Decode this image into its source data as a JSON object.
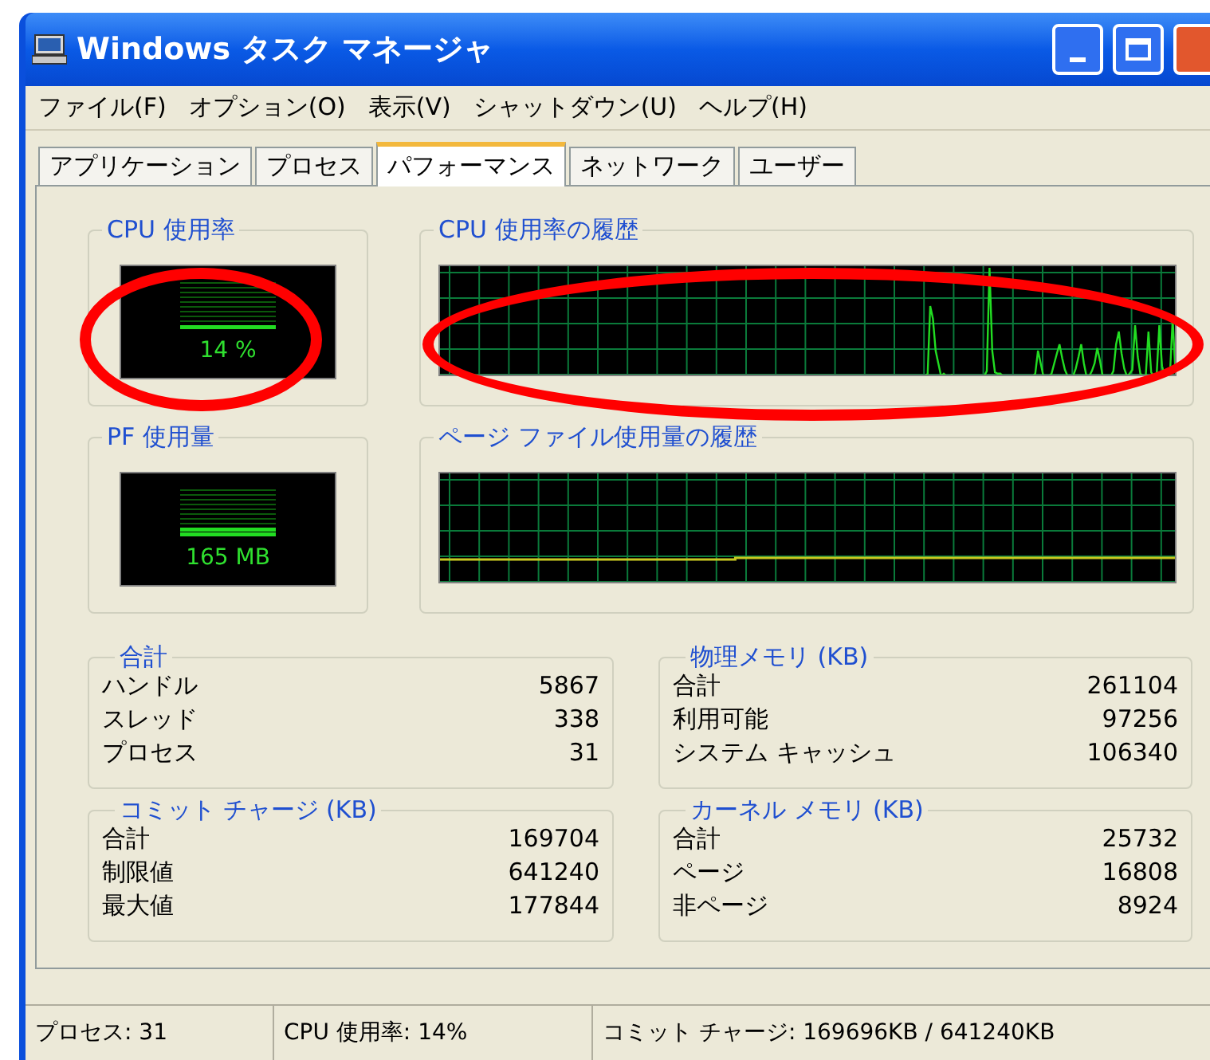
{
  "window": {
    "title": "Windows タスク マネージャ"
  },
  "menu": [
    "ファイル(F)",
    "オプション(O)",
    "表示(V)",
    "シャットダウン(U)",
    "ヘルプ(H)"
  ],
  "tabs": [
    {
      "label": "アプリケーション",
      "selected": false
    },
    {
      "label": "プロセス",
      "selected": false
    },
    {
      "label": "パフォーマンス",
      "selected": true
    },
    {
      "label": "ネットワーク",
      "selected": false
    },
    {
      "label": "ユーザー",
      "selected": false
    }
  ],
  "gauges": [
    {
      "title": "CPU 使用率",
      "reading": "14 %"
    },
    {
      "title": "PF 使用量",
      "reading": "165 MB"
    }
  ],
  "histories": [
    {
      "title": "CPU 使用率の履歴",
      "kind": "spikes"
    },
    {
      "title": "ページ ファイル使用量の履歴",
      "kind": "steps"
    }
  ],
  "groups": [
    {
      "title": "合計",
      "rows": [
        {
          "label": "ハンドル",
          "value": "5867"
        },
        {
          "label": "スレッド",
          "value": "338"
        },
        {
          "label": "プロセス",
          "value": "31"
        }
      ]
    },
    {
      "title": "物理メモリ (KB)",
      "rows": [
        {
          "label": "合計",
          "value": "261104"
        },
        {
          "label": "利用可能",
          "value": "97256"
        },
        {
          "label": "システム キャッシュ",
          "value": "106340"
        }
      ]
    },
    {
      "title": "コミット チャージ (KB)",
      "rows": [
        {
          "label": "合計",
          "value": "169704"
        },
        {
          "label": "制限値",
          "value": "641240"
        },
        {
          "label": "最大値",
          "value": "177844"
        }
      ]
    },
    {
      "title": "カーネル メモリ (KB)",
      "rows": [
        {
          "label": "合計",
          "value": "25732"
        },
        {
          "label": "ページ",
          "value": "16808"
        },
        {
          "label": "非ページ",
          "value": "8924"
        }
      ]
    }
  ],
  "status_bar": [
    "プロセス: 31",
    "CPU 使用率: 14%",
    "コミット チャージ: 169696KB / 641240KB"
  ],
  "annotations": [
    {
      "kind": "ellipse"
    },
    {
      "kind": "ellipse"
    }
  ]
}
